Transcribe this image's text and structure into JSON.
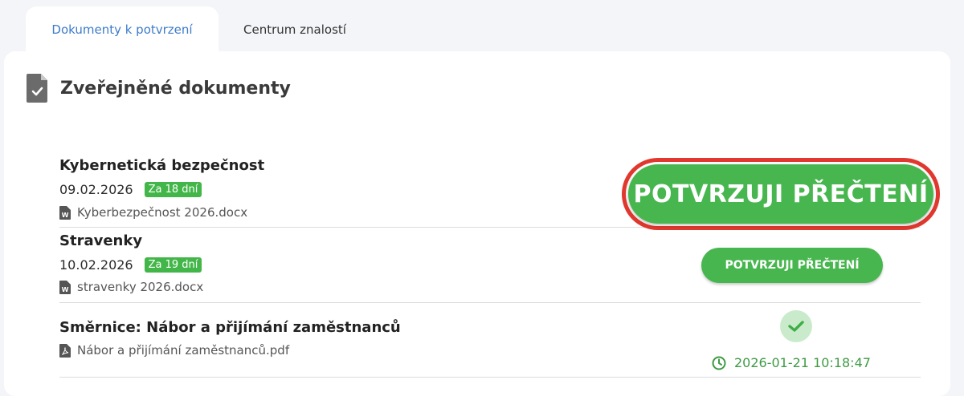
{
  "tabs": [
    {
      "label": "Dokumenty k potvrzení",
      "active": true
    },
    {
      "label": "Centrum znalostí",
      "active": false
    }
  ],
  "section": {
    "title": "Zveřejněné dokumenty",
    "icon": "document-check-icon"
  },
  "documents": [
    {
      "title": "Kybernetická bezpečnost",
      "date": "09.02.2026",
      "badge": "Za 18 dní",
      "file": "Kyberbezpečnost 2026.docx",
      "file_icon": "word-file-icon",
      "action_label": "POTVRZUJI PŘEČTENÍ",
      "highlighted": true
    },
    {
      "title": "Stravenky",
      "date": "10.02.2026",
      "badge": "Za 19 dní",
      "file": "stravenky 2026.docx",
      "file_icon": "word-file-icon",
      "action_label": "POTVRZUJI PŘEČTENÍ"
    },
    {
      "title": "Směrnice: Nábor a přijímání zaměstnanců",
      "file": "Nábor a přijímání zaměstnanců.pdf",
      "file_icon": "pdf-file-icon",
      "confirmed": true,
      "confirmed_at": "2026-01-21 10:18:47"
    }
  ],
  "colors": {
    "accent_green": "#48b64f",
    "badge_green": "#43b649",
    "highlight_red": "#e0382e",
    "tab_active_text": "#3d7cc9"
  }
}
